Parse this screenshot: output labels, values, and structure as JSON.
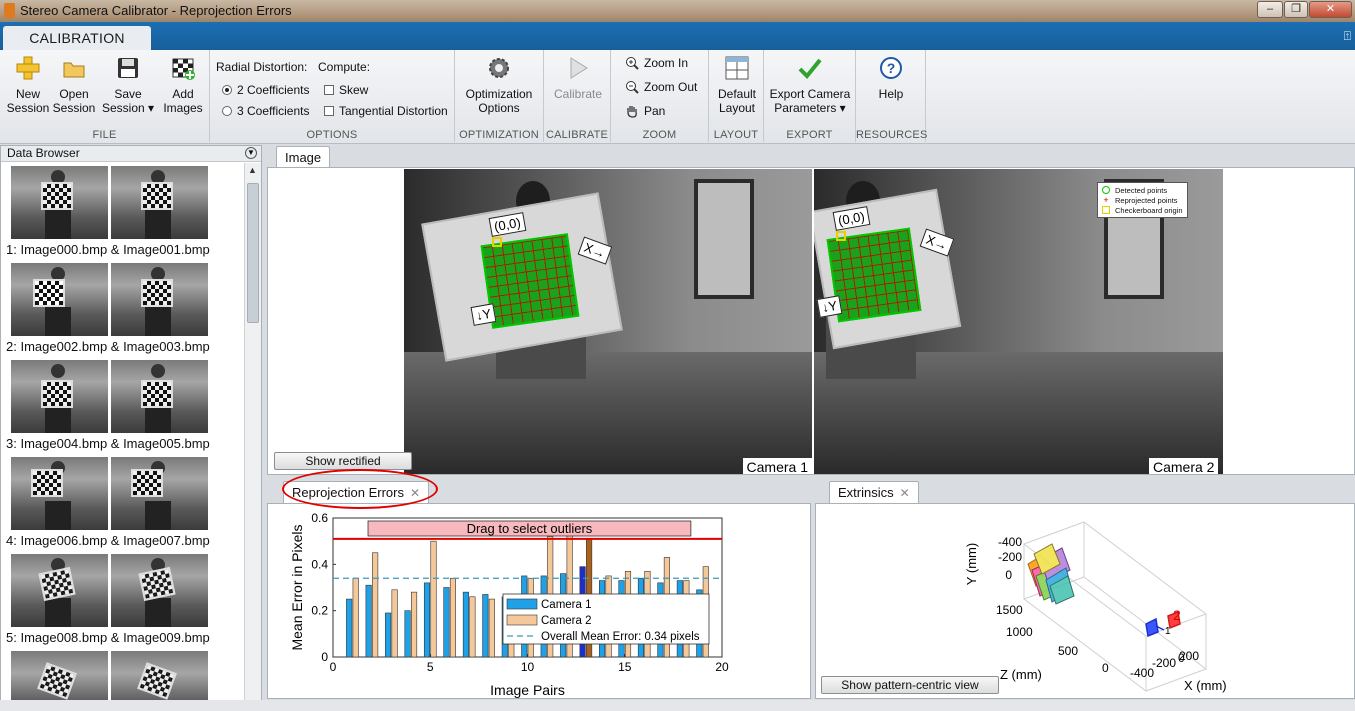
{
  "window": {
    "title": "Stereo Camera Calibrator - Reprojection Errors",
    "controls": {
      "minimize": "–",
      "maximize": "❐",
      "close": "✕"
    }
  },
  "ribbon": {
    "tab": "CALIBRATION",
    "collapse_glyph": "⍐",
    "file": {
      "label": "FILE",
      "new_session": [
        "New",
        "Session"
      ],
      "open_session": [
        "Open",
        "Session"
      ],
      "save_session": [
        "Save",
        "Session ▾"
      ],
      "add_images": [
        "Add",
        "Images"
      ]
    },
    "options": {
      "label": "OPTIONS",
      "radial_distortion": "Radial Distortion:",
      "two_coeff": "2 Coefficients",
      "three_coeff": "3 Coefficients",
      "compute": "Compute:",
      "skew": "Skew",
      "tangential": "Tangential Distortion"
    },
    "optimization": {
      "label": "OPTIMIZATION",
      "button": [
        "Optimization",
        "Options"
      ]
    },
    "calibrate": {
      "label": "CALIBRATE",
      "button": "Calibrate"
    },
    "zoom": {
      "label": "ZOOM",
      "zoom_in": "Zoom In",
      "zoom_out": "Zoom Out",
      "pan": "Pan"
    },
    "layout": {
      "label": "LAYOUT",
      "button": [
        "Default",
        "Layout"
      ]
    },
    "export": {
      "label": "EXPORT",
      "button": [
        "Export Camera",
        "Parameters ▾"
      ]
    },
    "resources": {
      "label": "RESOURCES",
      "button": "Help"
    }
  },
  "data_browser": {
    "title": "Data Browser",
    "items": [
      {
        "label": "1: Image000.bmp & Image001.bmp"
      },
      {
        "label": "2: Image002.bmp & Image003.bmp"
      },
      {
        "label": "3: Image004.bmp & Image005.bmp"
      },
      {
        "label": "4: Image006.bmp & Image007.bmp"
      },
      {
        "label": "5: Image008.bmp & Image009.bmp"
      },
      {
        "label": ""
      }
    ]
  },
  "image_panel": {
    "tab": "Image",
    "camera1": "Camera 1",
    "camera2": "Camera 2",
    "origin_label": "(0,0)",
    "x_label": "X→",
    "y_label": "↓Y",
    "show_rectified": "Show rectified",
    "legend": {
      "detected": "Detected points",
      "reprojected": "Reprojected points",
      "origin": "Checkerboard origin"
    }
  },
  "reprojection_panel": {
    "tab": "Reprojection Errors",
    "close_glyph": "✕"
  },
  "extrinsics_panel": {
    "tab": "Extrinsics",
    "close_glyph": "✕",
    "button": "Show pattern-centric view",
    "axes": {
      "y_label": "Y (mm)",
      "z_label": "Z (mm)",
      "x_label": "X (mm)",
      "y_ticks": [
        "-400",
        "-200",
        "0"
      ],
      "z_ticks": [
        "1500",
        "1000",
        "500",
        "0"
      ],
      "x_ticks": [
        "-400",
        "-200",
        "0",
        "200"
      ],
      "cam_labels": [
        "1",
        "2"
      ]
    }
  },
  "chart_data": {
    "type": "bar",
    "xlabel": "Image Pairs",
    "ylabel": "Mean Error in Pixels",
    "xlim": [
      0,
      20
    ],
    "ylim": [
      0,
      0.6
    ],
    "xticks": [
      0,
      5,
      10,
      15,
      20
    ],
    "yticks": [
      0,
      0.2,
      0.4,
      0.6
    ],
    "categories": [
      1,
      2,
      3,
      4,
      5,
      6,
      7,
      8,
      9,
      10,
      11,
      12,
      13,
      14,
      15,
      16,
      17,
      18,
      19
    ],
    "series": [
      {
        "name": "Camera 1",
        "color": "#1ea1e6",
        "values": [
          0.25,
          0.31,
          0.19,
          0.2,
          0.32,
          0.3,
          0.28,
          0.27,
          0.26,
          0.35,
          0.35,
          0.36,
          0.39,
          0.33,
          0.33,
          0.34,
          0.32,
          0.33,
          0.29
        ]
      },
      {
        "name": "Camera 2",
        "color": "#f5c89a",
        "values": [
          0.34,
          0.45,
          0.29,
          0.28,
          0.5,
          0.34,
          0.26,
          0.25,
          0.25,
          0.34,
          0.52,
          0.53,
          0.51,
          0.35,
          0.37,
          0.37,
          0.43,
          0.33,
          0.39
        ]
      }
    ],
    "highlighted_pair": 13,
    "highlight_colors": {
      "camera1": "#1d2fc8",
      "camera2": "#a8621e"
    },
    "overall_mean": {
      "value": 0.34,
      "label": "Overall Mean Error: 0.34 pixels"
    },
    "threshold": {
      "value": 0.51,
      "color": "#e00000"
    },
    "drag_banner": "Drag to select outliers",
    "legend_position": "bottom-right"
  }
}
